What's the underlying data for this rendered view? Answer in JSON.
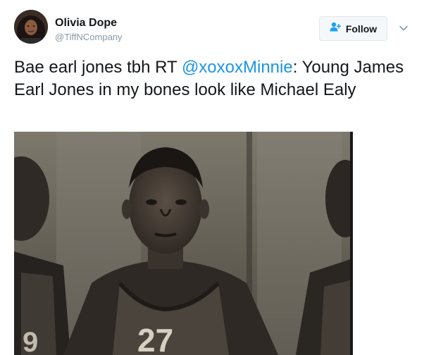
{
  "user": {
    "name": "Olivia Dope",
    "handle": "@TiffNCompany"
  },
  "follow_button": {
    "label": "Follow"
  },
  "tweet": {
    "text_before": "Bae earl jones tbh RT ",
    "mention": "@xoxoxMinnie",
    "text_after": ": Young James Earl Jones in my bones look like Michael Ealy"
  },
  "media": {
    "jersey_number": "27"
  },
  "colors": {
    "mention": "#1b95e0",
    "handle": "#8899a6",
    "follow_icon": "#1da1f2"
  },
  "icons": {
    "follow": "person-plus-icon",
    "menu": "chevron-down-icon"
  }
}
